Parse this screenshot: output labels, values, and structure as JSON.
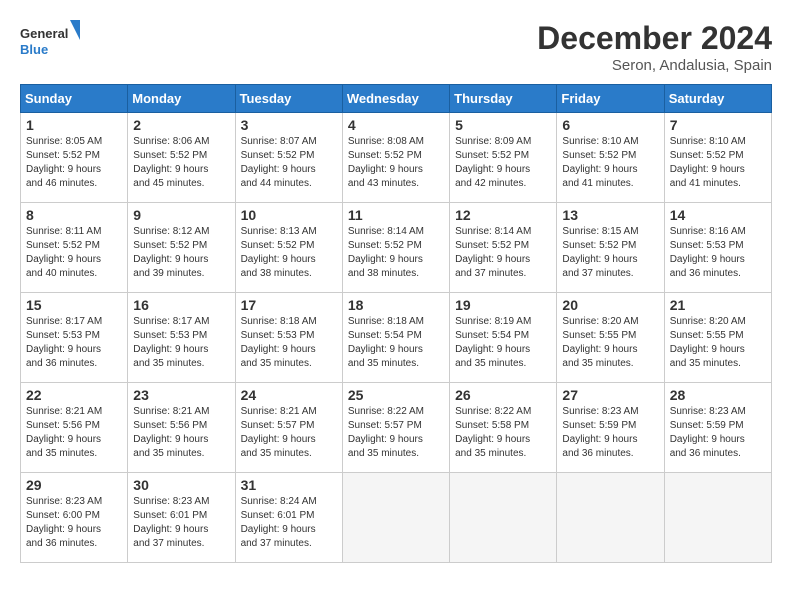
{
  "header": {
    "logo_line1": "General",
    "logo_line2": "Blue",
    "title": "December 2024",
    "subtitle": "Seron, Andalusia, Spain"
  },
  "weekdays": [
    "Sunday",
    "Monday",
    "Tuesday",
    "Wednesday",
    "Thursday",
    "Friday",
    "Saturday"
  ],
  "weeks": [
    [
      {
        "day": "1",
        "info": "Sunrise: 8:05 AM\nSunset: 5:52 PM\nDaylight: 9 hours\nand 46 minutes."
      },
      {
        "day": "2",
        "info": "Sunrise: 8:06 AM\nSunset: 5:52 PM\nDaylight: 9 hours\nand 45 minutes."
      },
      {
        "day": "3",
        "info": "Sunrise: 8:07 AM\nSunset: 5:52 PM\nDaylight: 9 hours\nand 44 minutes."
      },
      {
        "day": "4",
        "info": "Sunrise: 8:08 AM\nSunset: 5:52 PM\nDaylight: 9 hours\nand 43 minutes."
      },
      {
        "day": "5",
        "info": "Sunrise: 8:09 AM\nSunset: 5:52 PM\nDaylight: 9 hours\nand 42 minutes."
      },
      {
        "day": "6",
        "info": "Sunrise: 8:10 AM\nSunset: 5:52 PM\nDaylight: 9 hours\nand 41 minutes."
      },
      {
        "day": "7",
        "info": "Sunrise: 8:10 AM\nSunset: 5:52 PM\nDaylight: 9 hours\nand 41 minutes."
      }
    ],
    [
      {
        "day": "8",
        "info": "Sunrise: 8:11 AM\nSunset: 5:52 PM\nDaylight: 9 hours\nand 40 minutes."
      },
      {
        "day": "9",
        "info": "Sunrise: 8:12 AM\nSunset: 5:52 PM\nDaylight: 9 hours\nand 39 minutes."
      },
      {
        "day": "10",
        "info": "Sunrise: 8:13 AM\nSunset: 5:52 PM\nDaylight: 9 hours\nand 38 minutes."
      },
      {
        "day": "11",
        "info": "Sunrise: 8:14 AM\nSunset: 5:52 PM\nDaylight: 9 hours\nand 38 minutes."
      },
      {
        "day": "12",
        "info": "Sunrise: 8:14 AM\nSunset: 5:52 PM\nDaylight: 9 hours\nand 37 minutes."
      },
      {
        "day": "13",
        "info": "Sunrise: 8:15 AM\nSunset: 5:52 PM\nDaylight: 9 hours\nand 37 minutes."
      },
      {
        "day": "14",
        "info": "Sunrise: 8:16 AM\nSunset: 5:53 PM\nDaylight: 9 hours\nand 36 minutes."
      }
    ],
    [
      {
        "day": "15",
        "info": "Sunrise: 8:17 AM\nSunset: 5:53 PM\nDaylight: 9 hours\nand 36 minutes."
      },
      {
        "day": "16",
        "info": "Sunrise: 8:17 AM\nSunset: 5:53 PM\nDaylight: 9 hours\nand 35 minutes."
      },
      {
        "day": "17",
        "info": "Sunrise: 8:18 AM\nSunset: 5:53 PM\nDaylight: 9 hours\nand 35 minutes."
      },
      {
        "day": "18",
        "info": "Sunrise: 8:18 AM\nSunset: 5:54 PM\nDaylight: 9 hours\nand 35 minutes."
      },
      {
        "day": "19",
        "info": "Sunrise: 8:19 AM\nSunset: 5:54 PM\nDaylight: 9 hours\nand 35 minutes."
      },
      {
        "day": "20",
        "info": "Sunrise: 8:20 AM\nSunset: 5:55 PM\nDaylight: 9 hours\nand 35 minutes."
      },
      {
        "day": "21",
        "info": "Sunrise: 8:20 AM\nSunset: 5:55 PM\nDaylight: 9 hours\nand 35 minutes."
      }
    ],
    [
      {
        "day": "22",
        "info": "Sunrise: 8:21 AM\nSunset: 5:56 PM\nDaylight: 9 hours\nand 35 minutes."
      },
      {
        "day": "23",
        "info": "Sunrise: 8:21 AM\nSunset: 5:56 PM\nDaylight: 9 hours\nand 35 minutes."
      },
      {
        "day": "24",
        "info": "Sunrise: 8:21 AM\nSunset: 5:57 PM\nDaylight: 9 hours\nand 35 minutes."
      },
      {
        "day": "25",
        "info": "Sunrise: 8:22 AM\nSunset: 5:57 PM\nDaylight: 9 hours\nand 35 minutes."
      },
      {
        "day": "26",
        "info": "Sunrise: 8:22 AM\nSunset: 5:58 PM\nDaylight: 9 hours\nand 35 minutes."
      },
      {
        "day": "27",
        "info": "Sunrise: 8:23 AM\nSunset: 5:59 PM\nDaylight: 9 hours\nand 36 minutes."
      },
      {
        "day": "28",
        "info": "Sunrise: 8:23 AM\nSunset: 5:59 PM\nDaylight: 9 hours\nand 36 minutes."
      }
    ],
    [
      {
        "day": "29",
        "info": "Sunrise: 8:23 AM\nSunset: 6:00 PM\nDaylight: 9 hours\nand 36 minutes."
      },
      {
        "day": "30",
        "info": "Sunrise: 8:23 AM\nSunset: 6:01 PM\nDaylight: 9 hours\nand 37 minutes."
      },
      {
        "day": "31",
        "info": "Sunrise: 8:24 AM\nSunset: 6:01 PM\nDaylight: 9 hours\nand 37 minutes."
      },
      {
        "day": "",
        "info": ""
      },
      {
        "day": "",
        "info": ""
      },
      {
        "day": "",
        "info": ""
      },
      {
        "day": "",
        "info": ""
      }
    ]
  ]
}
